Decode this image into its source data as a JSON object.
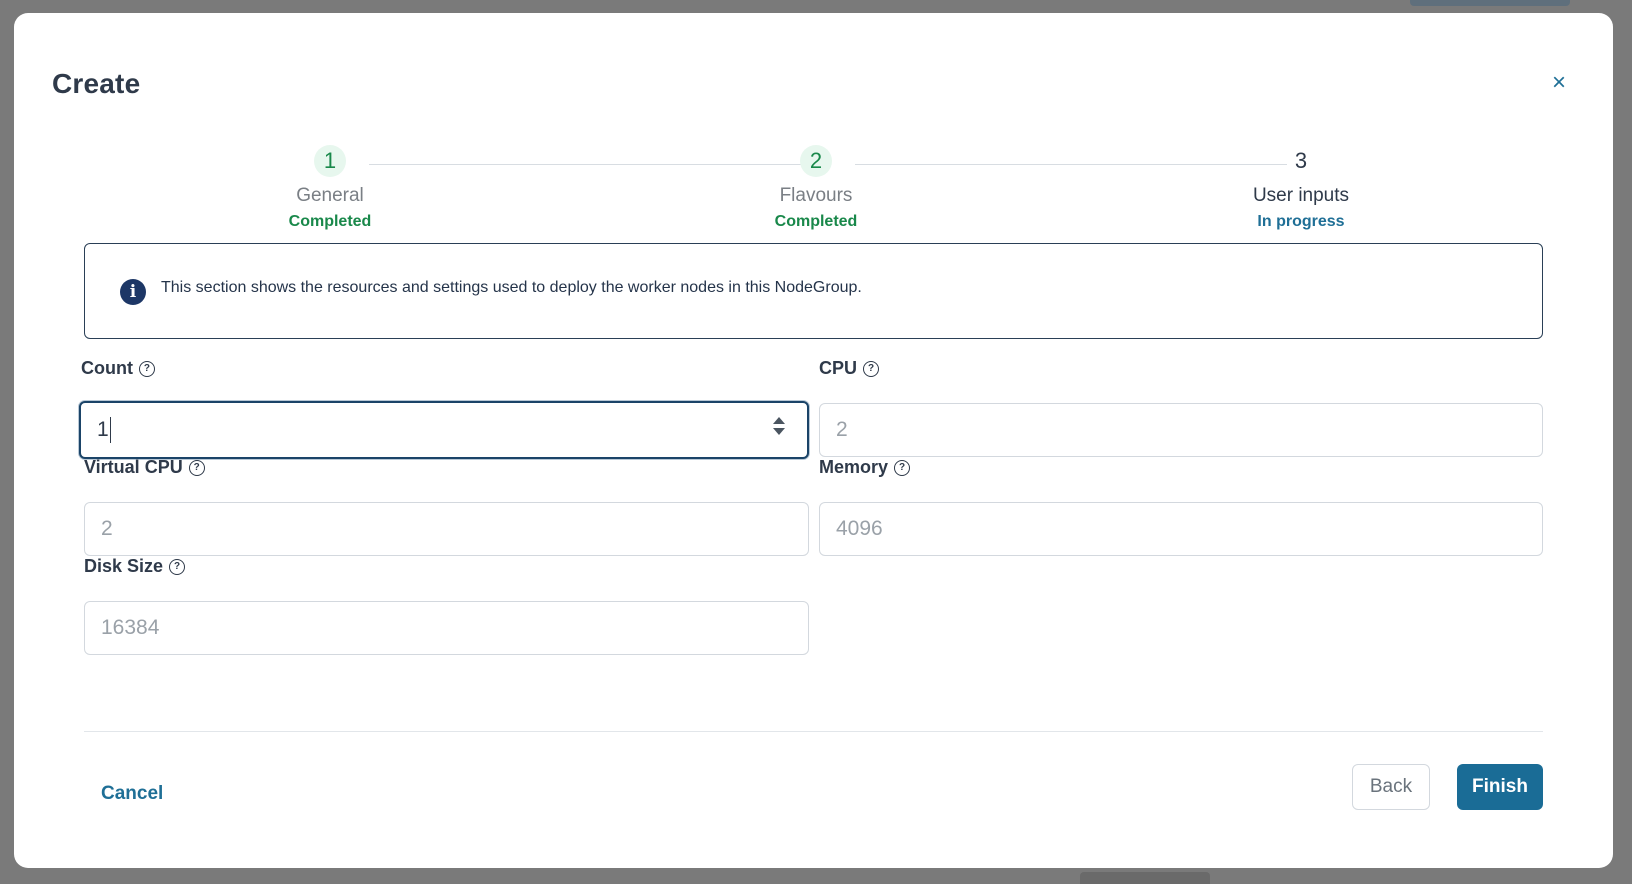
{
  "modal": {
    "title": "Create",
    "close_glyph": "×"
  },
  "stepper": {
    "steps": [
      {
        "number": "1",
        "label": "General",
        "status": "Completed"
      },
      {
        "number": "2",
        "label": "Flavours",
        "status": "Completed"
      },
      {
        "number": "3",
        "label": "User inputs",
        "status": "In progress"
      }
    ]
  },
  "info": {
    "icon": "info-icon",
    "text": "This section shows the resources and settings used to deploy the worker nodes in this NodeGroup."
  },
  "form": {
    "count": {
      "label": "Count",
      "value": "1"
    },
    "cpu": {
      "label": "CPU",
      "placeholder": "2"
    },
    "virtual_cpu": {
      "label": "Virtual CPU",
      "placeholder": "2"
    },
    "memory": {
      "label": "Memory",
      "placeholder": "4096"
    },
    "disk_size": {
      "label": "Disk Size",
      "placeholder": "16384"
    },
    "help_glyph": "?"
  },
  "footer": {
    "cancel": "Cancel",
    "back": "Back",
    "finish": "Finish"
  },
  "colors": {
    "primary": "#1a6c96",
    "success": "#19884a",
    "text": "#2f3a4a"
  }
}
